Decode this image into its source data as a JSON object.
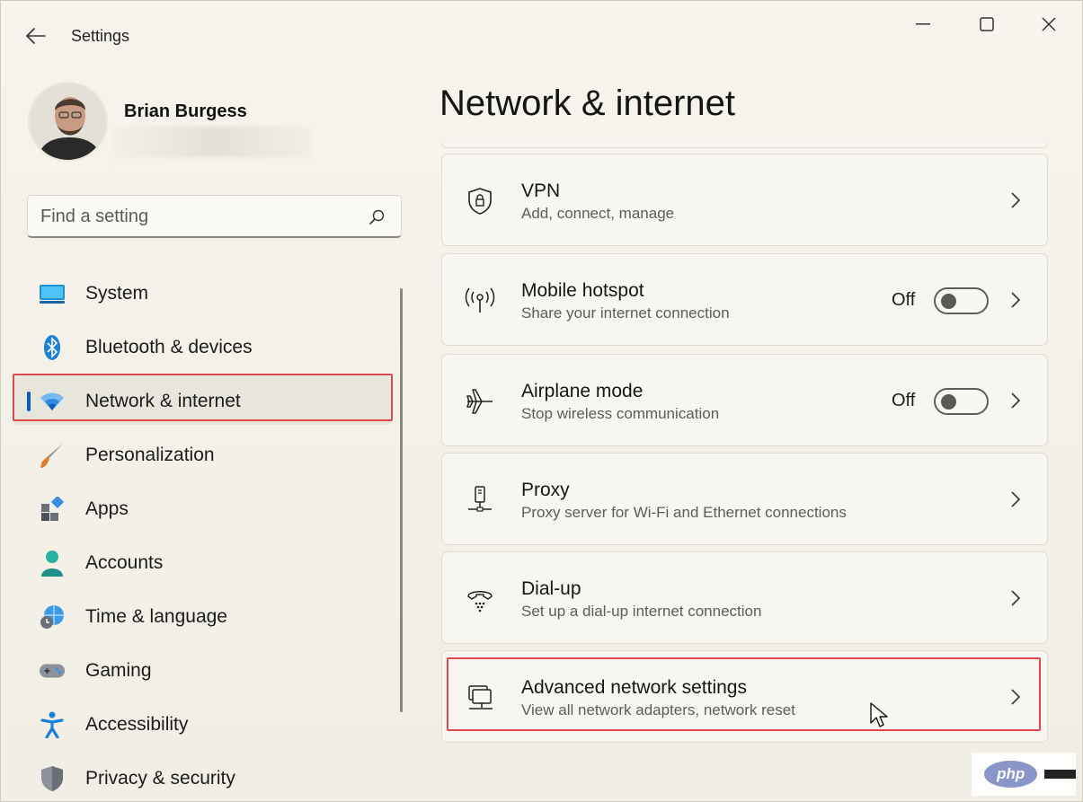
{
  "window": {
    "title": "Settings"
  },
  "profile": {
    "name": "Brian Burgess"
  },
  "search": {
    "placeholder": "Find a setting"
  },
  "sidebar": {
    "items": [
      {
        "label": "System",
        "icon": "system-icon"
      },
      {
        "label": "Bluetooth & devices",
        "icon": "bluetooth-icon"
      },
      {
        "label": "Network & internet",
        "icon": "wifi-icon",
        "selected": true
      },
      {
        "label": "Personalization",
        "icon": "brush-icon"
      },
      {
        "label": "Apps",
        "icon": "apps-icon"
      },
      {
        "label": "Accounts",
        "icon": "person-icon"
      },
      {
        "label": "Time & language",
        "icon": "globe-clock-icon"
      },
      {
        "label": "Gaming",
        "icon": "gamepad-icon"
      },
      {
        "label": "Accessibility",
        "icon": "accessibility-icon"
      },
      {
        "label": "Privacy & security",
        "icon": "shield-icon"
      }
    ]
  },
  "main": {
    "title": "Network & internet",
    "cards": [
      {
        "title": "VPN",
        "subtitle": "Add, connect, manage",
        "icon": "vpn-shield-icon"
      },
      {
        "title": "Mobile hotspot",
        "subtitle": "Share your internet connection",
        "icon": "hotspot-icon",
        "state": "Off"
      },
      {
        "title": "Airplane mode",
        "subtitle": "Stop wireless communication",
        "icon": "airplane-icon",
        "state": "Off"
      },
      {
        "title": "Proxy",
        "subtitle": "Proxy server for Wi-Fi and Ethernet connections",
        "icon": "proxy-icon"
      },
      {
        "title": "Dial-up",
        "subtitle": "Set up a dial-up internet connection",
        "icon": "dialup-icon"
      },
      {
        "title": "Advanced network settings",
        "subtitle": "View all network adapters, network reset",
        "icon": "network-adapter-icon"
      }
    ]
  },
  "watermark": {
    "text": "php"
  },
  "colors": {
    "accent": "#0a5fb4",
    "highlight_box": "#e0474c"
  }
}
